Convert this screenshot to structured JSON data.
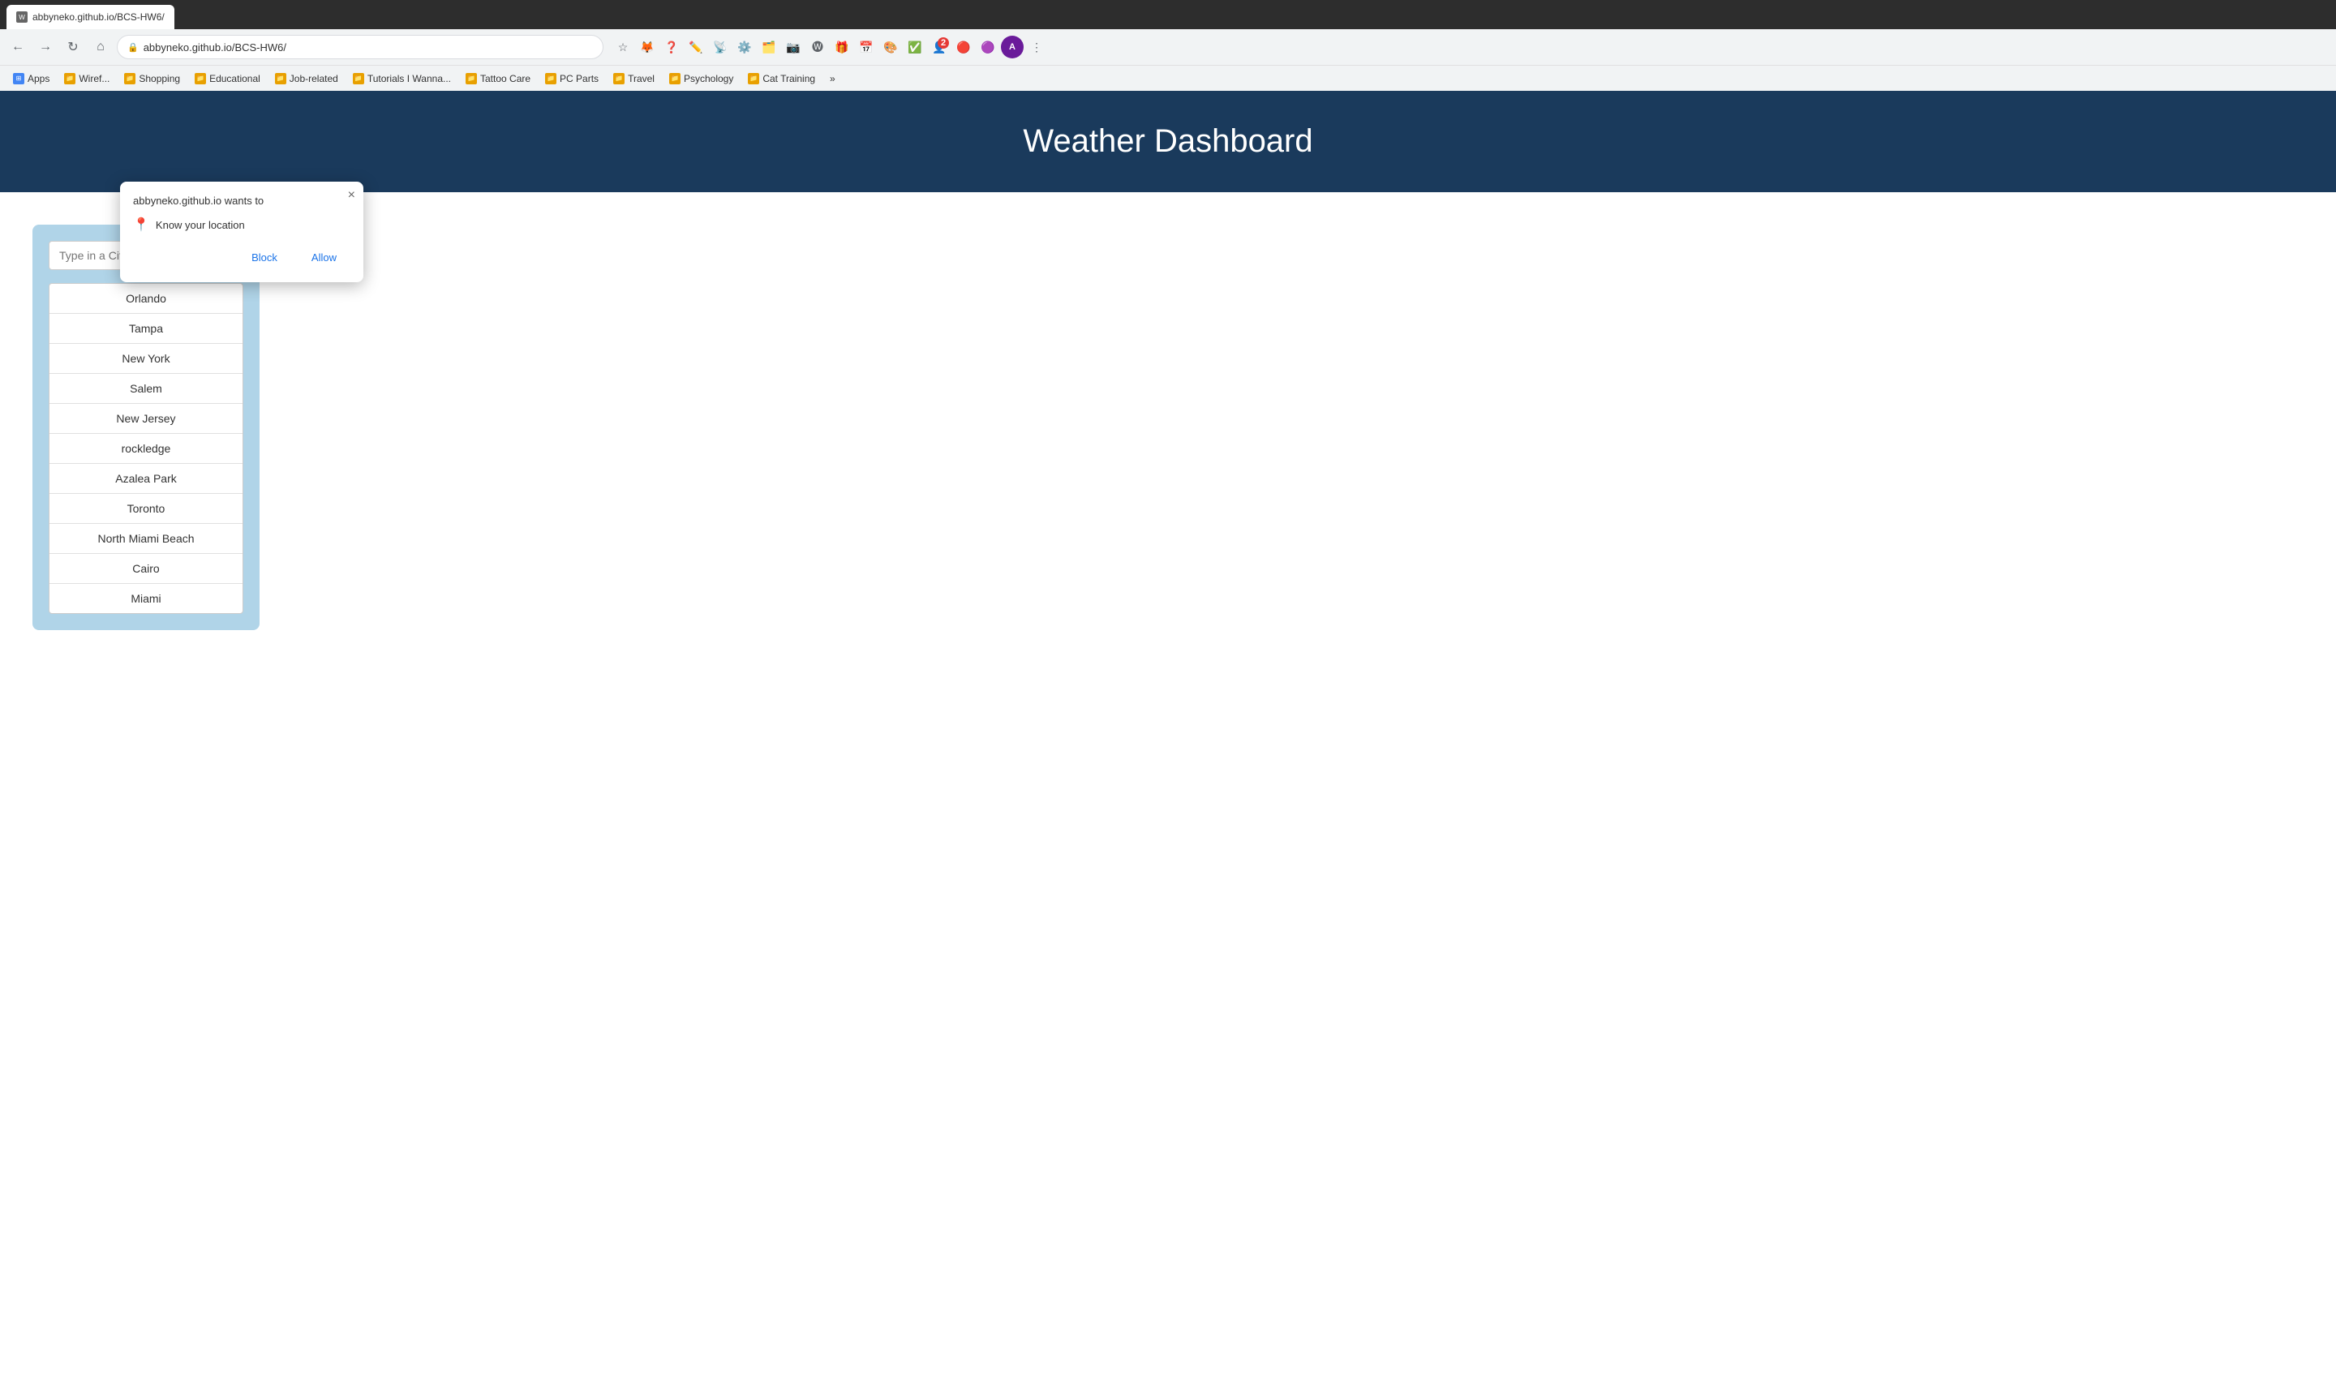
{
  "browser": {
    "tab_title": "abbyneko.github.io/BCS-HW6/",
    "url": "abbyneko.github.io/BCS-HW6/",
    "nav_back_label": "←",
    "nav_forward_label": "→",
    "nav_refresh_label": "↻",
    "nav_home_label": "⌂",
    "star_icon": "☆",
    "more_icon": "⋮"
  },
  "bookmarks": {
    "items": [
      {
        "label": "Apps",
        "icon": "grid"
      },
      {
        "label": "Wiref...",
        "icon": "folder"
      },
      {
        "label": "Shopping",
        "icon": "folder"
      },
      {
        "label": "Educational",
        "icon": "folder"
      },
      {
        "label": "Job-related",
        "icon": "folder"
      },
      {
        "label": "Tutorials I Wanna...",
        "icon": "folder"
      },
      {
        "label": "Tattoo Care",
        "icon": "folder"
      },
      {
        "label": "PC Parts",
        "icon": "folder"
      },
      {
        "label": "Travel",
        "icon": "folder"
      },
      {
        "label": "Psychology",
        "icon": "folder"
      },
      {
        "label": "Cat Training",
        "icon": "folder"
      },
      {
        "label": "»",
        "icon": null
      }
    ]
  },
  "popup": {
    "title": "abbyneko.github.io wants to",
    "permission": "Know your location",
    "block_label": "Block",
    "allow_label": "Allow",
    "close_label": "×"
  },
  "app": {
    "title": "Weather Dashboard",
    "search_placeholder": "Type in a City",
    "search_button_label": "🔍",
    "cities": [
      "Orlando",
      "Tampa",
      "New York",
      "Salem",
      "New Jersey",
      "rockledge",
      "Azalea Park",
      "Toronto",
      "North Miami Beach",
      "Cairo",
      "Miami"
    ]
  }
}
